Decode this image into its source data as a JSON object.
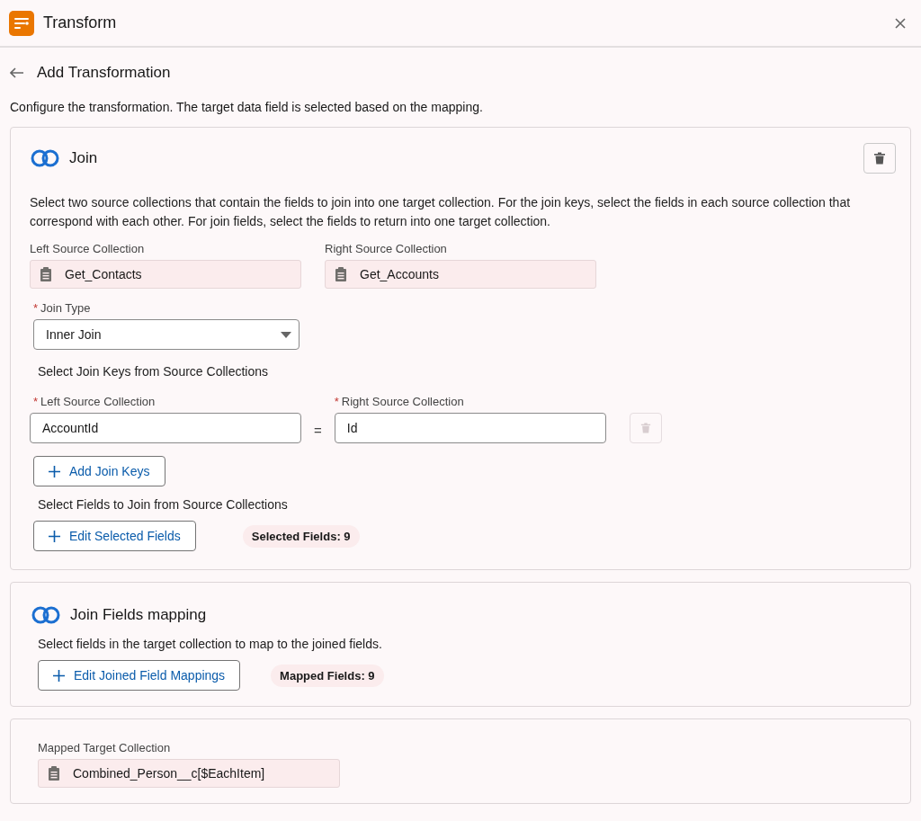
{
  "window": {
    "title": "Transform"
  },
  "page": {
    "title": "Add Transformation",
    "description": "Configure the transformation. The target data field is selected based on the mapping."
  },
  "join": {
    "title": "Join",
    "description": "Select two source collections that contain the fields to join into one target collection. For the join keys, select the fields in each source collection that correspond with each other. For join fields, select the fields to return into one target collection.",
    "sources": [
      {
        "label": "Left Source Collection",
        "value": "Get_Contacts"
      },
      {
        "label": "Right Source Collection",
        "value": "Get_Accounts"
      }
    ],
    "join_type": {
      "required_mark": "*",
      "label": "Join Type",
      "value": "Inner Join"
    },
    "keys_heading": "Select Join Keys from Source Collections",
    "keys": [
      {
        "left_required_mark": "*",
        "left_label": "Left Source Collection",
        "left_value": "AccountId",
        "operator": "=",
        "right_required_mark": "*",
        "right_label": "Right Source Collection",
        "right_value": "Id",
        "delete_disabled": true
      }
    ],
    "add_keys_button": "Add Join Keys",
    "fields_heading": "Select Fields to Join from Source Collections",
    "edit_fields_button": "Edit Selected Fields",
    "selected_badge": "Selected Fields: 9"
  },
  "mapping": {
    "title": "Join Fields mapping",
    "description": "Select fields in the target collection to map to the joined fields.",
    "edit_button": "Edit Joined Field Mappings",
    "mapped_badge": "Mapped Fields: 9"
  },
  "target": {
    "label": "Mapped Target Collection",
    "value": "Combined_Person__c[$EachItem]"
  }
}
